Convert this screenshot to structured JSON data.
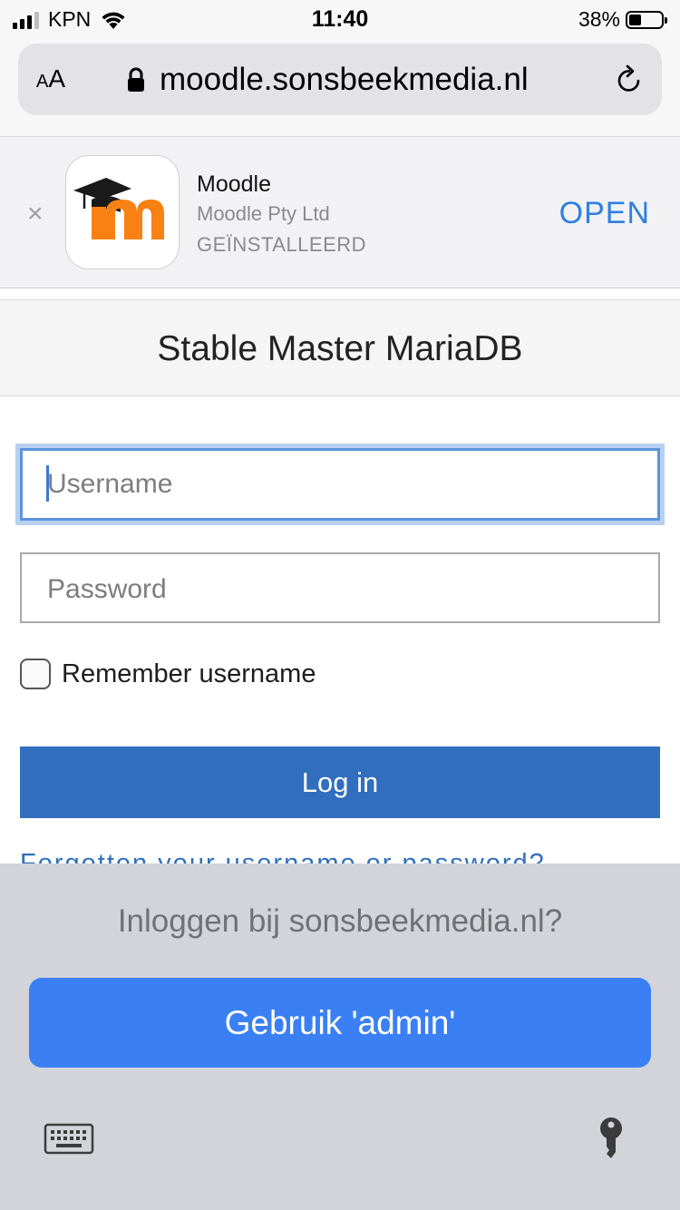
{
  "status_bar": {
    "carrier": "KPN",
    "time": "11:40",
    "battery": "38%",
    "battery_level": 0.38,
    "signal_bars": 3
  },
  "address_bar": {
    "text_size_label": "AA",
    "url": "moodle.sonsbeekmedia.nl",
    "icons": [
      "lock-icon",
      "reload-icon"
    ]
  },
  "app_banner": {
    "app_name": "Moodle",
    "vendor": "Moodle Pty Ltd",
    "status": "GEÏNSTALLEERD",
    "action": "OPEN",
    "close_icon": "×"
  },
  "page": {
    "site_title": "Stable Master MariaDB",
    "username_placeholder": "Username",
    "password_placeholder": "Password",
    "remember_label": "Remember username",
    "remember_checked": false,
    "login_button": "Log in",
    "forgot_link": "Forgotten your username or password?"
  },
  "password_bar": {
    "prompt": "Inloggen bij sonsbeekmedia.nl?",
    "use_button": "Gebruik 'admin'",
    "icons": [
      "keyboard-icon",
      "key-icon"
    ]
  },
  "colors": {
    "accent_blue": "#316ebe",
    "banner_open": "#2f7fe0",
    "suggest_button": "#3a80f4",
    "moodle_orange": "#f98012"
  }
}
